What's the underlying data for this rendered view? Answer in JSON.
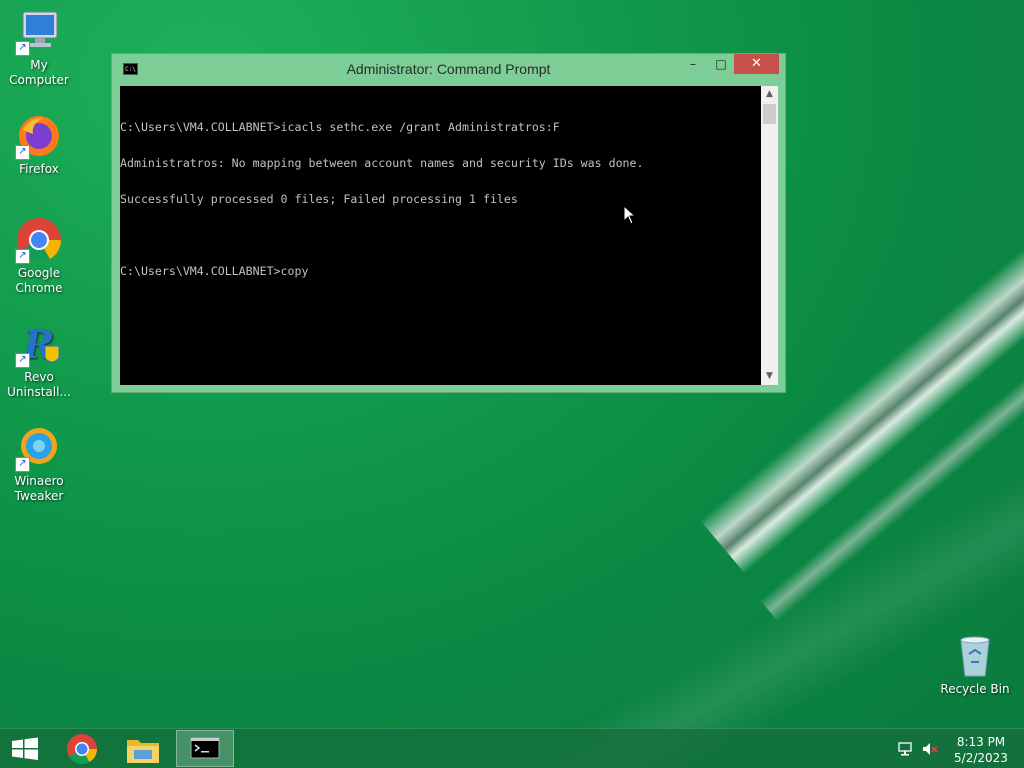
{
  "desktop": {
    "icons": [
      {
        "label": "My Computer"
      },
      {
        "label": "Firefox"
      },
      {
        "label_line1": "Google",
        "label_line2": "Chrome"
      },
      {
        "label_line1": "Revo",
        "label_line2": "Uninstall..."
      },
      {
        "label_line1": "Winaero",
        "label_line2": "Tweaker"
      },
      {
        "label": "Recycle Bin"
      }
    ]
  },
  "window": {
    "title": "Administrator: Command Prompt",
    "icon_text": "C:\\",
    "minimize_glyph": "–",
    "maximize_glyph": "□",
    "close_glyph": "✕",
    "console_lines": [
      "C:\\Users\\VM4.COLLABNET>icacls sethc.exe /grant Administratros:F",
      "Administratros: No mapping between account names and security IDs was done.",
      "Successfully processed 0 files; Failed processing 1 files",
      "",
      "C:\\Users\\VM4.COLLABNET>copy"
    ],
    "scroll_up_glyph": "▲",
    "scroll_down_glyph": "▼"
  },
  "taskbar": {
    "start_icon": "windows-logo",
    "pinned": [
      "chrome-icon",
      "file-explorer-icon",
      "command-prompt-icon"
    ],
    "tray": {
      "network_icon": "network-icon",
      "volume_icon": "volume-muted-icon",
      "time": "8:13 PM",
      "date": "5/2/2023"
    }
  },
  "colors": {
    "desktop_green": "#0b8a44",
    "window_frame": "#7dcd96",
    "close_button": "#c7504b",
    "console_bg": "#000000",
    "console_text": "#c0c0c0"
  }
}
